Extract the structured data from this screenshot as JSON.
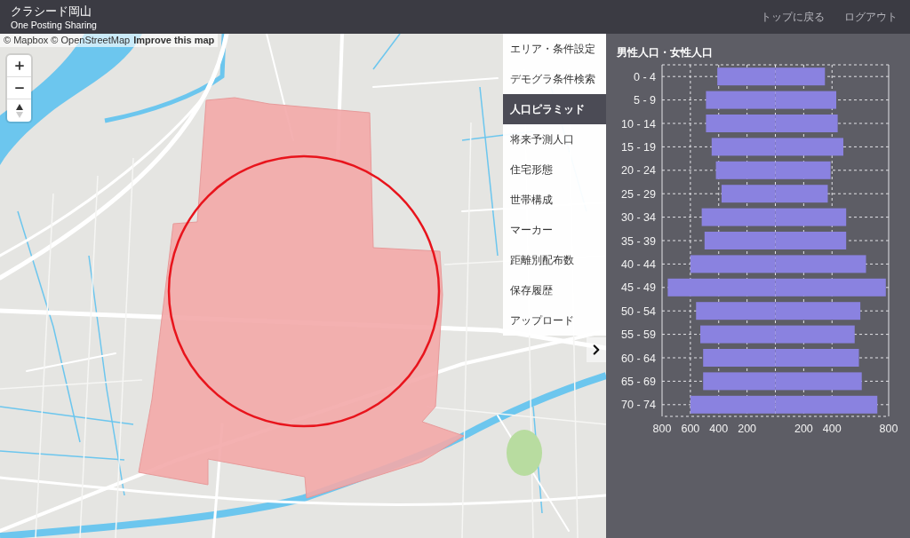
{
  "header": {
    "title": "クラシード岡山",
    "subtitle": "One Posting Sharing",
    "links": [
      "トップに戻る",
      "ログアウト"
    ]
  },
  "map": {
    "attribution": "© Mapbox © OpenStreetMap",
    "attribution_link": "Improve this map"
  },
  "menu": {
    "items": [
      {
        "label": "エリア・条件設定",
        "selected": false
      },
      {
        "label": "デモグラ条件検索",
        "selected": false
      },
      {
        "label": "人口ピラミッド",
        "selected": true
      },
      {
        "label": "将来予測人口",
        "selected": false
      },
      {
        "label": "住宅形態",
        "selected": false
      },
      {
        "label": "世帯構成",
        "selected": false
      },
      {
        "label": "マーカー",
        "selected": false
      },
      {
        "label": "距離別配布数",
        "selected": false
      },
      {
        "label": "保存履歴",
        "selected": false
      },
      {
        "label": "アップロード",
        "selected": false
      }
    ]
  },
  "pyramid": {
    "chart_data": {
      "type": "bar",
      "orientation": "horizontal",
      "stacked": true,
      "grid": true,
      "title": "男性人口・女性人口",
      "categories": [
        "0 - 4",
        "5 - 9",
        "10 - 14",
        "15 - 19",
        "20 - 24",
        "25 - 29",
        "30 - 34",
        "35 - 39",
        "40 - 44",
        "45 - 49",
        "50 - 54",
        "55 - 59",
        "60 - 64",
        "65 - 69",
        "70 - 74"
      ],
      "series": [
        {
          "color": "#8a82e0",
          "values": [
            -410,
            -490,
            -490,
            -450,
            -420,
            -380,
            -520,
            -500,
            -600,
            -760,
            -560,
            -530,
            -510,
            -510,
            -600
          ]
        },
        {
          "color": "#8a82e0",
          "values": [
            350,
            430,
            440,
            480,
            390,
            370,
            500,
            500,
            640,
            780,
            600,
            560,
            590,
            610,
            720
          ]
        }
      ],
      "xlim": [
        -800,
        800
      ],
      "xticks": [
        {
          "value": -800,
          "label": "800"
        },
        {
          "value": -600,
          "label": "600"
        },
        {
          "value": -400,
          "label": "400"
        },
        {
          "value": -200,
          "label": "200"
        },
        {
          "value": 200,
          "label": "200"
        },
        {
          "value": 400,
          "label": "400"
        },
        {
          "value": 800,
          "label": "800"
        }
      ]
    }
  }
}
